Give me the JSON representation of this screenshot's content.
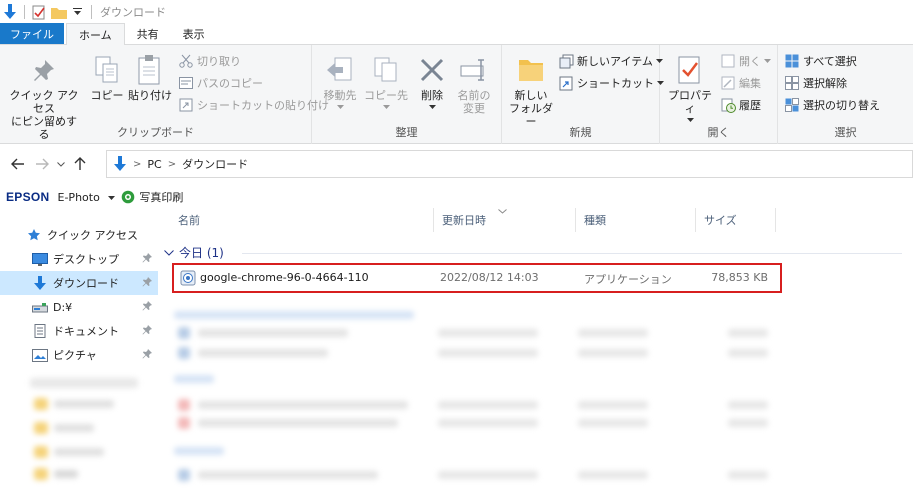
{
  "window": {
    "title": "ダウンロード"
  },
  "tabs": {
    "file": "ファイル",
    "home": "ホーム",
    "share": "共有",
    "view": "表示"
  },
  "ribbon": {
    "clipboard": {
      "label": "クリップボード",
      "pin_line1": "クイック アクセス",
      "pin_line2": "にピン留めする",
      "copy": "コピー",
      "paste": "貼り付け",
      "cut": "切り取り",
      "copy_path": "パスのコピー",
      "paste_shortcut": "ショートカットの貼り付け"
    },
    "organize": {
      "label": "整理",
      "move_to": "移動先",
      "copy_to": "コピー先",
      "delete": "削除",
      "rename_line1": "名前の",
      "rename_line2": "変更"
    },
    "new": {
      "label": "新規",
      "new_folder_line1": "新しい",
      "new_folder_line2": "フォルダー",
      "new_item": "新しいアイテム",
      "easy_access": "ショートカット"
    },
    "open": {
      "label": "開く",
      "properties": "プロパティ",
      "open": "開く",
      "edit": "編集",
      "history": "履歴"
    },
    "select": {
      "label": "選択",
      "select_all": "すべて選択",
      "select_none": "選択解除",
      "invert": "選択の切り替え"
    }
  },
  "address": {
    "crumbs": [
      "PC",
      "ダウンロード"
    ]
  },
  "epson": {
    "brand": "EPSON",
    "app": "E-Photo",
    "menu": "写真印刷"
  },
  "nav": {
    "quick_access": "クイック アクセス",
    "items": [
      {
        "label": "デスクトップ"
      },
      {
        "label": "ダウンロード"
      },
      {
        "label": "D:¥"
      },
      {
        "label": "ドキュメント"
      },
      {
        "label": "ピクチャ"
      }
    ]
  },
  "columns": {
    "name": "名前",
    "date": "更新日時",
    "type": "種類",
    "size": "サイズ"
  },
  "group": {
    "title": "今日 (1)"
  },
  "files": [
    {
      "name": "google-chrome-96-0-4664-110",
      "date": "2022/08/12 14:03",
      "type": "アプリケーション",
      "size": "78,853 KB"
    }
  ]
}
